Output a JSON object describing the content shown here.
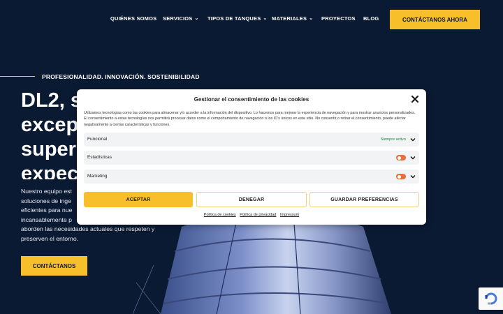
{
  "nav": {
    "items": [
      {
        "label": "QUIÉNES SOMOS",
        "dropdown": false
      },
      {
        "label": "SERVICIOS",
        "dropdown": true
      },
      {
        "label": "TIPOS DE TANQUES",
        "dropdown": true
      },
      {
        "label": "MATERIALES",
        "dropdown": true
      },
      {
        "label": "PROYECTOS",
        "dropdown": false
      },
      {
        "label": "BLOG",
        "dropdown": false
      }
    ],
    "cta": "CONTÁCTANOS AHORA",
    "chevron": "⌄"
  },
  "hero": {
    "tagline": "PROFESIONALIDAD. INNOVACIÓN. SOSTENIBILIDAD",
    "title_lines": [
      "DL2, s",
      "excep",
      "super",
      "expec"
    ],
    "body_lines": [
      "Nuestro equipo est",
      "soluciones de inge",
      "eficientes para nue",
      "incansablemente p",
      "aborden las necesidades actuales que respeten y",
      "preserven el entorno."
    ],
    "cta": "CONTÁCTANOS"
  },
  "cookie_modal": {
    "title": "Gestionar el consentimiento de las cookies",
    "text": "Utilizamos tecnologías como las cookies para almacenar y/o acceder a la información del dispositivo. Lo hacemos para mejorar la experiencia de navegación y para mostrar anuncios personalizados. El consentimiento a estas tecnologías nos permitirá procesar datos como el comportamiento de navegación o los ID's únicos en este sitio. No consentir o retirar el consentimiento, puede afectar negativamente a ciertas características y funciones.",
    "categories": [
      {
        "label": "Funcional",
        "status": "Siempre activo"
      },
      {
        "label": "Estadísticas",
        "status": ""
      },
      {
        "label": "Marketing",
        "status": ""
      }
    ],
    "buttons": {
      "accept": "ACEPTAR",
      "deny": "DENEGAR",
      "save": "GUARDAR PREFERENCIAS"
    },
    "links": [
      "Política de cookies",
      "Política de privacidad",
      "Impressum"
    ]
  },
  "colors": {
    "accent": "#f7bf2a",
    "background": "#0b1a33",
    "toggle": "#e8703a",
    "active": "#1c8a3e"
  },
  "icons": {
    "close": "close-icon",
    "chevron": "chevron-down-icon",
    "recaptcha": "recaptcha-icon"
  }
}
